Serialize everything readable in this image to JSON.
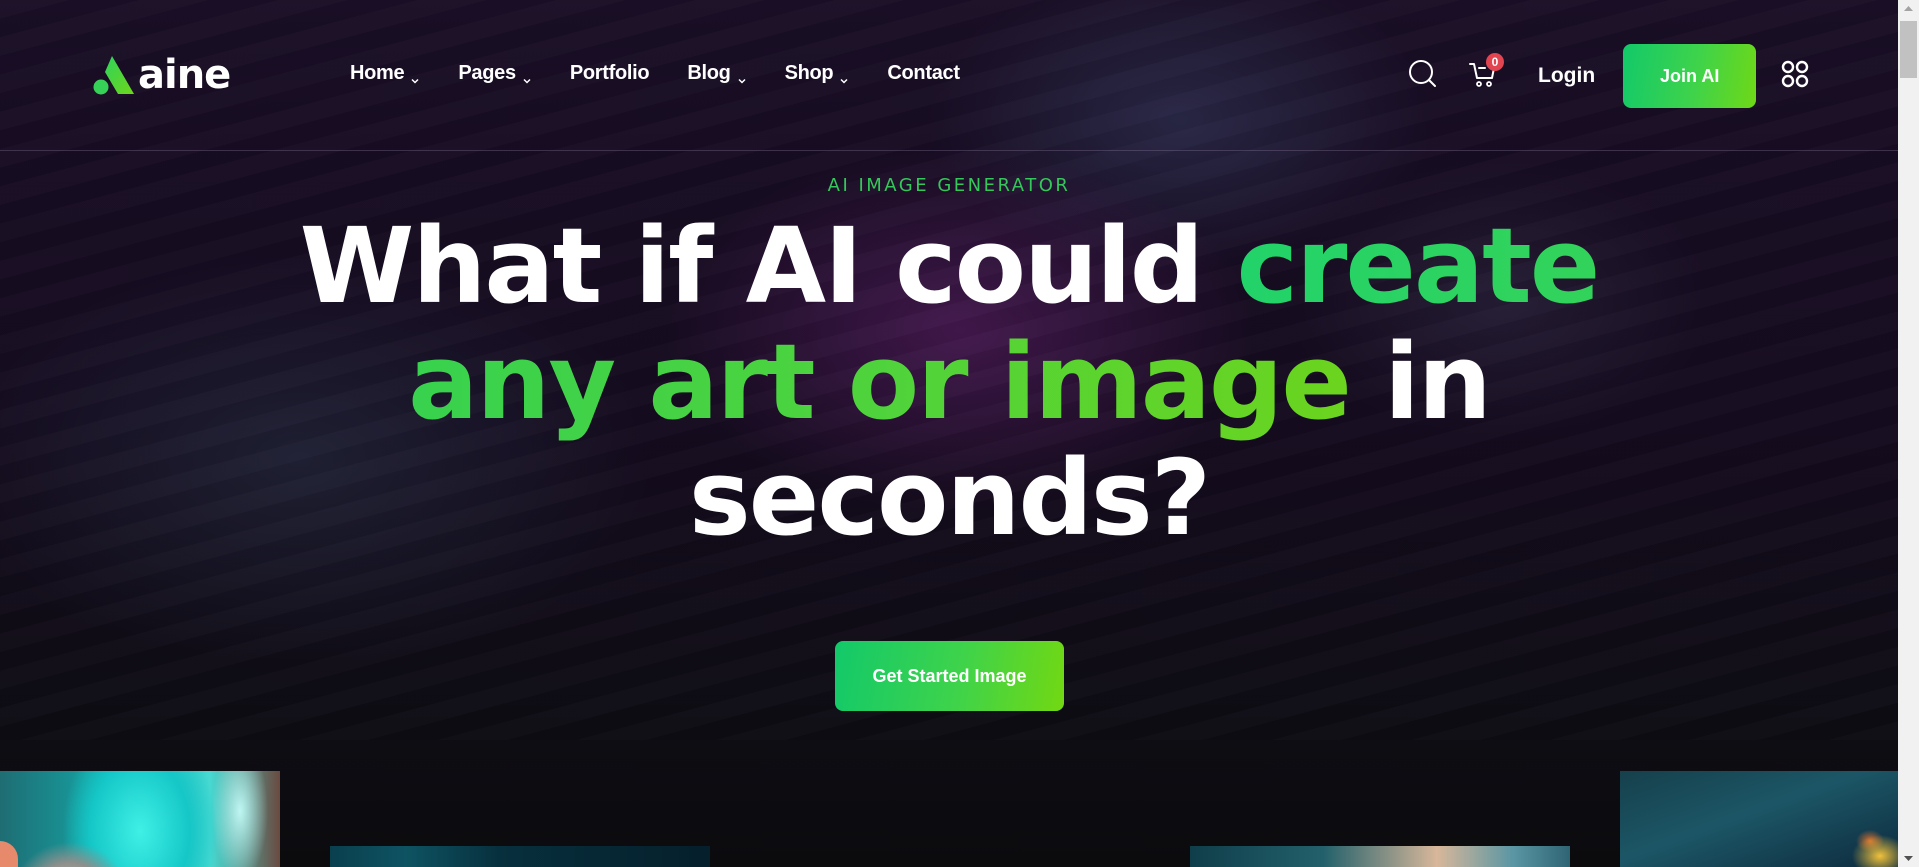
{
  "header": {
    "logo_text": "aine",
    "nav": [
      {
        "label": "Home",
        "has_dropdown": true
      },
      {
        "label": "Pages",
        "has_dropdown": true
      },
      {
        "label": "Portfolio",
        "has_dropdown": false
      },
      {
        "label": "Blog",
        "has_dropdown": true
      },
      {
        "label": "Shop",
        "has_dropdown": true
      },
      {
        "label": "Contact",
        "has_dropdown": false
      }
    ],
    "search_icon": "search-icon",
    "cart_icon": "cart-icon",
    "cart_count": "0",
    "login_label": "Login",
    "join_label": "Join AI",
    "menu_icon": "grid-menu-icon"
  },
  "hero": {
    "eyebrow": "AI IMAGE GENERATOR",
    "headline": {
      "line1_white": "What if AI could ",
      "line1_green": "create",
      "line2_green": "any art or image",
      "line2_white": " in",
      "line3_white": "seconds?"
    },
    "cta_label": "Get Started Image"
  },
  "gallery": {
    "images": [
      {
        "description": "Portrait of woman with grey curly hair and turquoise background"
      },
      {
        "description": "Dark teal space scene"
      },
      {
        "description": "Sunset sky with clouds"
      },
      {
        "description": "Teal sky with flowers and crescent moon"
      }
    ]
  },
  "colors": {
    "accent_green": "#34c759",
    "gradient_start": "#12c96a",
    "gradient_end": "#72d812",
    "badge_red": "#e2454f",
    "background": "#150b1f"
  }
}
